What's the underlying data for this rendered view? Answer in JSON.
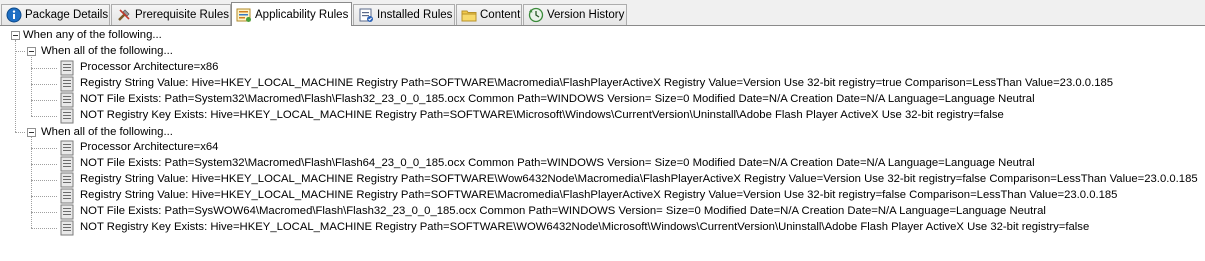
{
  "tabs": [
    {
      "label": "Package Details",
      "icon": "info-icon"
    },
    {
      "label": "Prerequisite Rules",
      "icon": "tools-icon"
    },
    {
      "label": "Applicability Rules",
      "icon": "rules-icon",
      "selected": true
    },
    {
      "label": "Installed Rules",
      "icon": "installed-icon"
    },
    {
      "label": "Content",
      "icon": "folder-icon"
    },
    {
      "label": "Version History",
      "icon": "history-icon"
    }
  ],
  "tree": {
    "root": "When any of the following...",
    "group1": {
      "label": "When all of the following...",
      "items": [
        "Processor Architecture=x86",
        "Registry String Value: Hive=HKEY_LOCAL_MACHINE Registry Path=SOFTWARE\\Macromedia\\FlashPlayerActiveX Registry Value=Version Use 32-bit registry=true Comparison=LessThan Value=23.0.0.185",
        "NOT File Exists: Path=System32\\Macromed\\Flash\\Flash32_23_0_0_185.ocx Common Path=WINDOWS Version= Size=0 Modified Date=N/A Creation Date=N/A Language=Language Neutral",
        "NOT Registry Key Exists: Hive=HKEY_LOCAL_MACHINE Registry Path=SOFTWARE\\Microsoft\\Windows\\CurrentVersion\\Uninstall\\Adobe Flash Player ActiveX Use 32-bit registry=false"
      ]
    },
    "group2": {
      "label": "When all of the following...",
      "items": [
        "Processor Architecture=x64",
        "NOT File Exists: Path=System32\\Macromed\\Flash\\Flash64_23_0_0_185.ocx Common Path=WINDOWS Version= Size=0 Modified Date=N/A Creation Date=N/A Language=Language Neutral",
        "Registry String Value: Hive=HKEY_LOCAL_MACHINE Registry Path=SOFTWARE\\Wow6432Node\\Macromedia\\FlashPlayerActiveX Registry Value=Version Use 32-bit registry=false Comparison=LessThan Value=23.0.0.185",
        "Registry String Value: Hive=HKEY_LOCAL_MACHINE Registry Path=SOFTWARE\\Macromedia\\FlashPlayerActiveX Registry Value=Version Use 32-bit registry=false Comparison=LessThan Value=23.0.0.185",
        "NOT File Exists: Path=SysWOW64\\Macromed\\Flash\\Flash32_23_0_0_185.ocx Common Path=WINDOWS Version= Size=0 Modified Date=N/A Creation Date=N/A Language=Language Neutral",
        "NOT Registry Key Exists: Hive=HKEY_LOCAL_MACHINE Registry Path=SOFTWARE\\WOW6432Node\\Microsoft\\Windows\\CurrentVersion\\Uninstall\\Adobe Flash Player ActiveX Use 32-bit registry=false"
      ]
    }
  }
}
